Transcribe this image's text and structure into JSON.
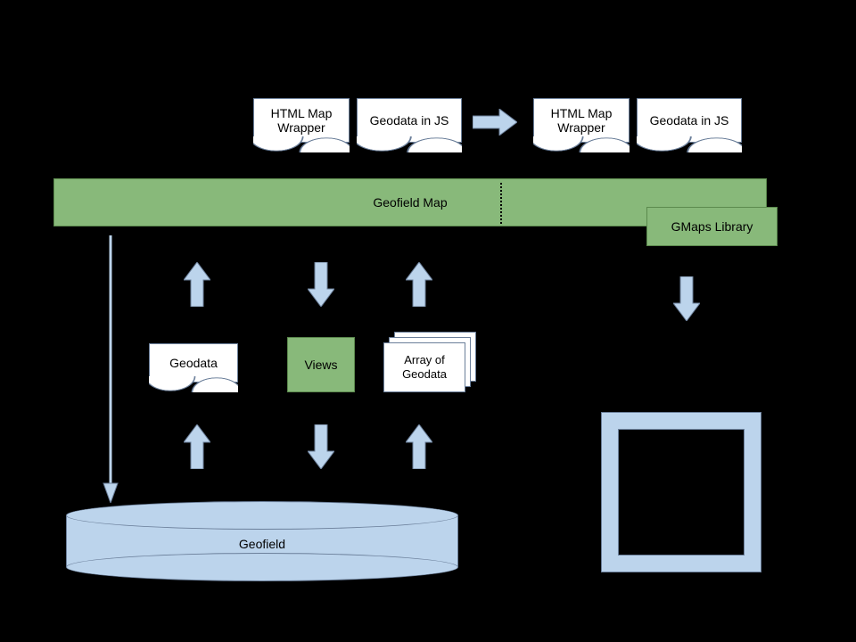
{
  "top_docs": {
    "left_a": "HTML Map Wrapper",
    "left_b": "Geodata in JS",
    "right_a": "HTML Map Wrapper",
    "right_b": "Geodata in JS"
  },
  "bar": {
    "label": "Geofield Map",
    "side_label": "GMaps Library"
  },
  "mid": {
    "geodata_doc": "Geodata",
    "views_box": "Views",
    "array_doc": "Array of Geodata"
  },
  "cylinder": {
    "label": "Geofield"
  }
}
